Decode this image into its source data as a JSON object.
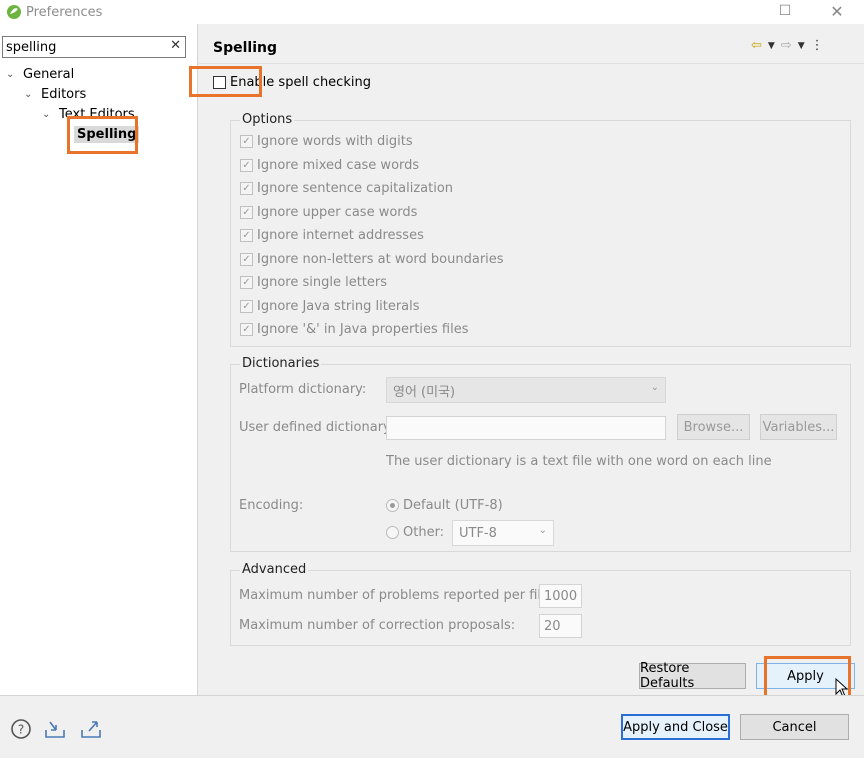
{
  "window": {
    "title": "Preferences",
    "maximize_icon": "maximize-icon",
    "close_icon": "close-icon"
  },
  "filter": {
    "value": "spelling"
  },
  "tree": [
    {
      "label": "General",
      "expanded": true
    },
    {
      "label": "Editors",
      "expanded": true
    },
    {
      "label": "Text Editors",
      "expanded": true
    },
    {
      "label": "Spelling",
      "selected": true
    }
  ],
  "page": {
    "title": "Spelling"
  },
  "enable_spell": {
    "label_pre": "Ena",
    "label_post": "ble spell checking",
    "checked": false
  },
  "options": {
    "title": "Options",
    "items": [
      "Ignore words with digits",
      "Ignore mixed case words",
      "Ignore sentence capitalization",
      "Ignore upper case words",
      "Ignore internet addresses",
      "Ignore non-letters at word boundaries",
      "Ignore single letters",
      "Ignore Java string literals",
      "Ignore '&' in Java properties files"
    ]
  },
  "dictionaries": {
    "title": "Dictionaries",
    "platform_label": "Platform dictionary:",
    "platform_value": "영어 (미국)",
    "user_label": "User defined dictionary:",
    "browse": "Browse...",
    "variables": "Variables...",
    "hint": "The user dictionary is a text file with one word on each line",
    "encoding_label": "Encoding:",
    "default_label": "Default (UTF-8)",
    "other_label": "Other:",
    "other_value": "UTF-8"
  },
  "advanced": {
    "title": "Advanced",
    "max_problems_label": "Maximum number of problems reported per file:",
    "max_problems_value": "1000",
    "max_corrections_label": "Maximum number of correction proposals:",
    "max_corrections_value": "20"
  },
  "buttons": {
    "restore_defaults": "Restore Defaults",
    "apply": "Apply",
    "apply_and_close": "Apply and Close",
    "cancel": "Cancel"
  },
  "colors": {
    "highlight": "#e8732b",
    "primary_border": "#2b6fd6"
  }
}
